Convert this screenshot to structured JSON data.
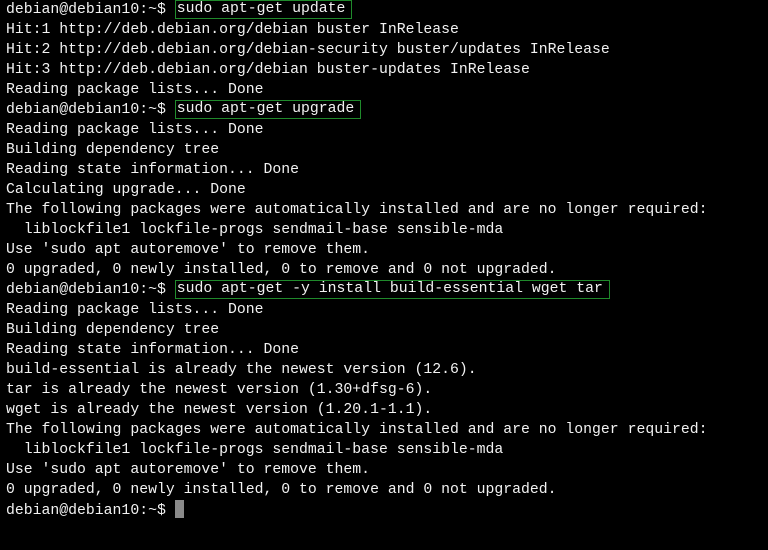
{
  "terminal": {
    "prompt": "debian@debian10:~$ ",
    "accent_color": "#1f8a2b",
    "lines": [
      {
        "type": "command",
        "command": "sudo apt-get update"
      },
      {
        "type": "output",
        "text": "Hit:1 http://deb.debian.org/debian buster InRelease"
      },
      {
        "type": "output",
        "text": "Hit:2 http://deb.debian.org/debian-security buster/updates InRelease"
      },
      {
        "type": "output",
        "text": "Hit:3 http://deb.debian.org/debian buster-updates InRelease"
      },
      {
        "type": "output",
        "text": "Reading package lists... Done"
      },
      {
        "type": "command",
        "command": "sudo apt-get upgrade"
      },
      {
        "type": "output",
        "text": "Reading package lists... Done"
      },
      {
        "type": "output",
        "text": "Building dependency tree"
      },
      {
        "type": "output",
        "text": "Reading state information... Done"
      },
      {
        "type": "output",
        "text": "Calculating upgrade... Done"
      },
      {
        "type": "output",
        "text": "The following packages were automatically installed and are no longer required:"
      },
      {
        "type": "output",
        "text": "  liblockfile1 lockfile-progs sendmail-base sensible-mda"
      },
      {
        "type": "output",
        "text": "Use 'sudo apt autoremove' to remove them."
      },
      {
        "type": "output",
        "text": "0 upgraded, 0 newly installed, 0 to remove and 0 not upgraded."
      },
      {
        "type": "command",
        "command": "sudo apt-get -y install build-essential wget tar"
      },
      {
        "type": "output",
        "text": "Reading package lists... Done"
      },
      {
        "type": "output",
        "text": "Building dependency tree"
      },
      {
        "type": "output",
        "text": "Reading state information... Done"
      },
      {
        "type": "output",
        "text": "build-essential is already the newest version (12.6)."
      },
      {
        "type": "output",
        "text": "tar is already the newest version (1.30+dfsg-6)."
      },
      {
        "type": "output",
        "text": "wget is already the newest version (1.20.1-1.1)."
      },
      {
        "type": "output",
        "text": "The following packages were automatically installed and are no longer required:"
      },
      {
        "type": "output",
        "text": "  liblockfile1 lockfile-progs sendmail-base sensible-mda"
      },
      {
        "type": "output",
        "text": "Use 'sudo apt autoremove' to remove them."
      },
      {
        "type": "output",
        "text": "0 upgraded, 0 newly installed, 0 to remove and 0 not upgraded."
      },
      {
        "type": "input",
        "command": ""
      }
    ]
  }
}
